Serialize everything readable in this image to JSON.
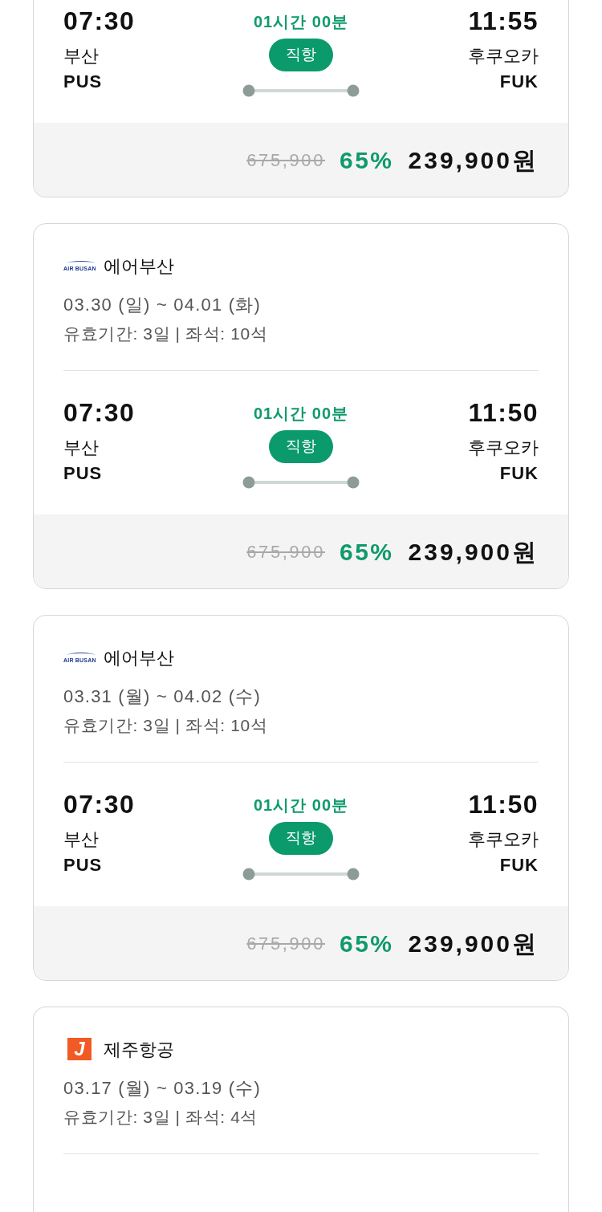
{
  "flights": [
    {
      "route": {
        "depart_time": "07:30",
        "depart_city": "부산",
        "depart_code": "PUS",
        "duration": "01시간 00분",
        "badge": "직항",
        "arrive_time": "11:55",
        "arrive_city": "후쿠오카",
        "arrive_code": "FUK"
      },
      "price": {
        "original": "675,900",
        "discount": "65%",
        "final": "239,900원"
      }
    },
    {
      "airline": {
        "logo": {
          "kind": "swoosh",
          "text": "AIR BUSAN"
        },
        "name": "에어부산"
      },
      "dates": "03.30 (일) ~ 04.01 (화)",
      "validity": "유효기간: 3일 | 좌석: 10석",
      "route": {
        "depart_time": "07:30",
        "depart_city": "부산",
        "depart_code": "PUS",
        "duration": "01시간 00분",
        "badge": "직항",
        "arrive_time": "11:50",
        "arrive_city": "후쿠오카",
        "arrive_code": "FUK"
      },
      "price": {
        "original": "675,900",
        "discount": "65%",
        "final": "239,900원"
      }
    },
    {
      "airline": {
        "logo": {
          "kind": "swoosh",
          "text": "AIR BUSAN"
        },
        "name": "에어부산"
      },
      "dates": "03.31 (월) ~ 04.02 (수)",
      "validity": "유효기간: 3일 | 좌석: 10석",
      "route": {
        "depart_time": "07:30",
        "depart_city": "부산",
        "depart_code": "PUS",
        "duration": "01시간 00분",
        "badge": "직항",
        "arrive_time": "11:50",
        "arrive_city": "후쿠오카",
        "arrive_code": "FUK"
      },
      "price": {
        "original": "675,900",
        "discount": "65%",
        "final": "239,900원"
      }
    },
    {
      "airline": {
        "logo": {
          "kind": "tile",
          "text": "J"
        },
        "name": "제주항공"
      },
      "dates": "03.17 (월) ~ 03.19 (수)",
      "validity": "유효기간: 3일 | 좌석: 4석"
    }
  ]
}
